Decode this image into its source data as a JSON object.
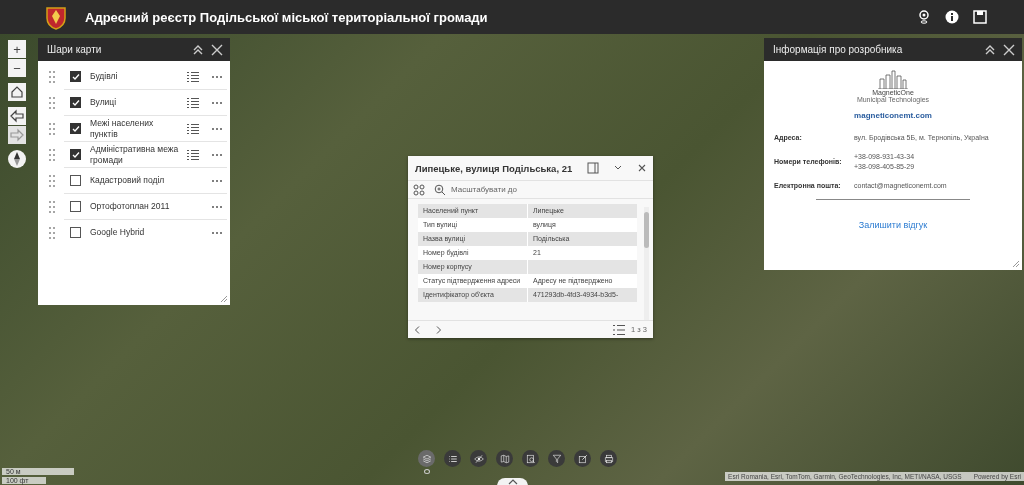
{
  "header": {
    "title": "Адресний реєстр Подільської міської територіальної громади",
    "actions": [
      {
        "kind": "account"
      },
      {
        "kind": "info"
      },
      {
        "kind": "save"
      }
    ]
  },
  "map_controls": [
    {
      "kind": "zoom-in",
      "label": "+"
    },
    {
      "kind": "zoom-out",
      "label": "−"
    },
    {
      "kind": "home"
    },
    {
      "kind": "back"
    },
    {
      "kind": "forward",
      "disabled": true
    },
    {
      "kind": "compass"
    }
  ],
  "layers_panel": {
    "title": "Шари карти",
    "layers": [
      {
        "label": "Будівлі",
        "checked": true,
        "legend": true
      },
      {
        "label": "Вулиці",
        "checked": true,
        "legend": true
      },
      {
        "label": "Межі населених пунктів",
        "checked": true,
        "legend": true
      },
      {
        "label": "Адміністративна межа громади",
        "checked": true,
        "legend": true
      },
      {
        "label": "Кадастровий поділ",
        "checked": false,
        "legend": false
      },
      {
        "label": "Ортофотоплан 2011",
        "checked": false,
        "legend": false
      },
      {
        "label": "Google Hybrid",
        "checked": false,
        "legend": false
      }
    ]
  },
  "popup": {
    "title": "Липецьке, вулиця Подільська, 21",
    "zoom_label": "Масштабувати до",
    "rows": [
      {
        "label": "Населений пункт",
        "value": "Липецьке"
      },
      {
        "label": "Тип вулиці",
        "value": "вулиця"
      },
      {
        "label": "Назва вулиці",
        "value": "Подільська"
      },
      {
        "label": "Номер будівлі",
        "value": "21"
      },
      {
        "label": "Номер корпусу",
        "value": ""
      },
      {
        "label": "Статус підтвердження адреси",
        "value": "Адресу не підтверджено"
      },
      {
        "label": "Ідентифікатор об'єкта",
        "value": "471293db-4fd3-4934-b3d5-"
      }
    ],
    "counter": "1 з 3"
  },
  "info_panel": {
    "title": "Інформація про розробника",
    "logo_name": "MagneticOne",
    "logo_tagline": "Municipal Technologies",
    "website": "magneticonemt.com",
    "fields": [
      {
        "label": "Адреса:",
        "values": [
          "вул. Бродівська 5Б, м. Тернопіль, Україна"
        ]
      },
      {
        "label": "Номери телефонів:",
        "values": [
          "+38-098-931-43-34",
          "+38-098-405-85-29"
        ]
      },
      {
        "label": "Електронна пошта:",
        "values": [
          "contact@magneticonemt.com"
        ]
      }
    ],
    "feedback": "Залишити відгук"
  },
  "toolbar": [
    {
      "kind": "layers",
      "selected": true
    },
    {
      "kind": "list",
      "selected": false
    },
    {
      "kind": "eye",
      "selected": false
    },
    {
      "kind": "map",
      "selected": false
    },
    {
      "kind": "search",
      "selected": false
    },
    {
      "kind": "filter",
      "selected": false
    },
    {
      "kind": "edit",
      "selected": false
    },
    {
      "kind": "print",
      "selected": false
    }
  ],
  "scale_bar": [
    "50 м",
    "100 фт"
  ],
  "attribution": "Esri Romania, Esri, TomTom, Garmin, GeoTechnologies, Inc, METI/NASA, USGS",
  "powered_by": "Powered by Esri"
}
